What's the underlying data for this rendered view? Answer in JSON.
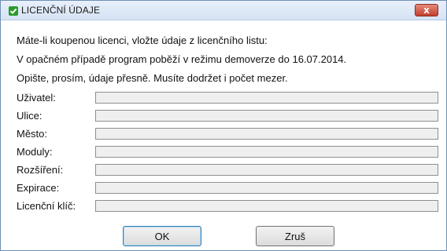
{
  "window": {
    "title": "LICENČNÍ ÚDAJE",
    "close_glyph": "x",
    "icon": "app-check-icon",
    "close_color": "#c1402e"
  },
  "messages": [
    "Máte-li koupenou licenci, vložte údaje z licenčního listu:",
    "V opačném případě program poběží v režimu demoverze do 16.07.2014.",
    "Opište, prosím, údaje přesně. Musíte dodržet i počet mezer."
  ],
  "fields": [
    {
      "label": "Uživatel:",
      "value": ""
    },
    {
      "label": "Ulice:",
      "value": ""
    },
    {
      "label": "Město:",
      "value": ""
    },
    {
      "label": "Moduly:",
      "value": ""
    },
    {
      "label": "Rozšíření:",
      "value": ""
    },
    {
      "label": "Expirace:",
      "value": ""
    },
    {
      "label": "Licenční klíč:",
      "value": ""
    }
  ],
  "buttons": {
    "ok": "OK",
    "cancel": "Zruš"
  }
}
